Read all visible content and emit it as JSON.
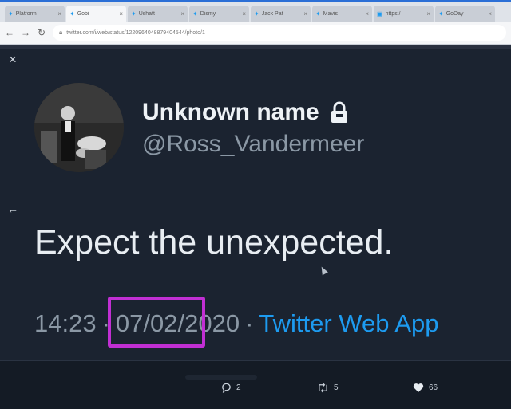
{
  "browser": {
    "tabs": [
      {
        "title": "Platform",
        "active": false
      },
      {
        "title": "Gobi",
        "active": true
      },
      {
        "title": "Ushatt",
        "active": false
      },
      {
        "title": "Dismy",
        "active": false
      },
      {
        "title": "Jack Pat",
        "active": false
      },
      {
        "title": "Mavis",
        "active": false
      },
      {
        "title": "https:/",
        "active": false
      },
      {
        "title": "GoDay",
        "active": false
      }
    ],
    "url": "twitter.com/i/web/status/1220964048879404544/photo/1"
  },
  "tweet": {
    "display_name": "Unknown name",
    "handle": "@Ross_Vandermeer",
    "text": "Expect the unexpected.",
    "time": "14:23",
    "separator": "·",
    "date": "07/02/2020",
    "source": "Twitter Web App"
  },
  "actions": {
    "replies": "2",
    "retweets": "5",
    "likes": "66"
  },
  "colors": {
    "background": "#1b2330",
    "accent": "#1d9bf0",
    "highlight": "#c12fd3"
  }
}
